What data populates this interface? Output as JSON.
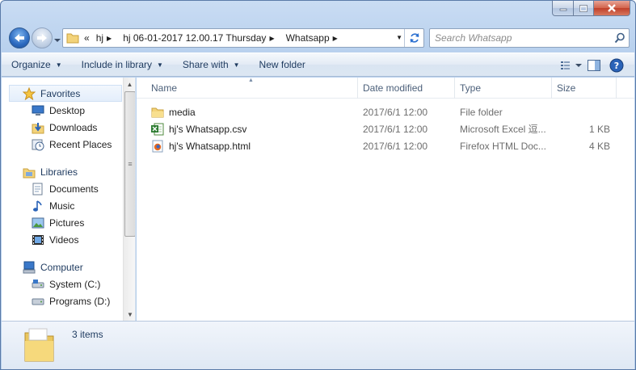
{
  "address": {
    "overflow": "«",
    "crumbs": [
      "hj",
      "hj 06-01-2017 12.00.17 Thursday",
      "Whatsapp"
    ]
  },
  "search": {
    "placeholder": "Search Whatsapp"
  },
  "toolbar": {
    "organize": "Organize",
    "include": "Include in library",
    "share": "Share with",
    "newfolder": "New folder"
  },
  "nav": {
    "favorites": {
      "title": "Favorites",
      "items": [
        "Desktop",
        "Downloads",
        "Recent Places"
      ]
    },
    "libraries": {
      "title": "Libraries",
      "items": [
        "Documents",
        "Music",
        "Pictures",
        "Videos"
      ]
    },
    "computer": {
      "title": "Computer",
      "items": [
        "System (C:)",
        "Programs (D:)"
      ]
    }
  },
  "columns": {
    "name": "Name",
    "date": "Date modified",
    "type": "Type",
    "size": "Size"
  },
  "files": [
    {
      "name": "media",
      "date": "2017/6/1 12:00",
      "type": "File folder",
      "size": "",
      "icon": "folder-icon"
    },
    {
      "name": "hj's Whatsapp.csv",
      "date": "2017/6/1 12:00",
      "type": "Microsoft Excel 逗...",
      "size": "1 KB",
      "icon": "excel-icon"
    },
    {
      "name": "hj's Whatsapp.html",
      "date": "2017/6/1 12:00",
      "type": "Firefox HTML Doc...",
      "size": "4 KB",
      "icon": "firefox-icon"
    }
  ],
  "details": {
    "count": "3 items"
  },
  "colors": {
    "accent": "#1e3a5f",
    "window": "#b9d1ee",
    "close": "#c0402a"
  }
}
